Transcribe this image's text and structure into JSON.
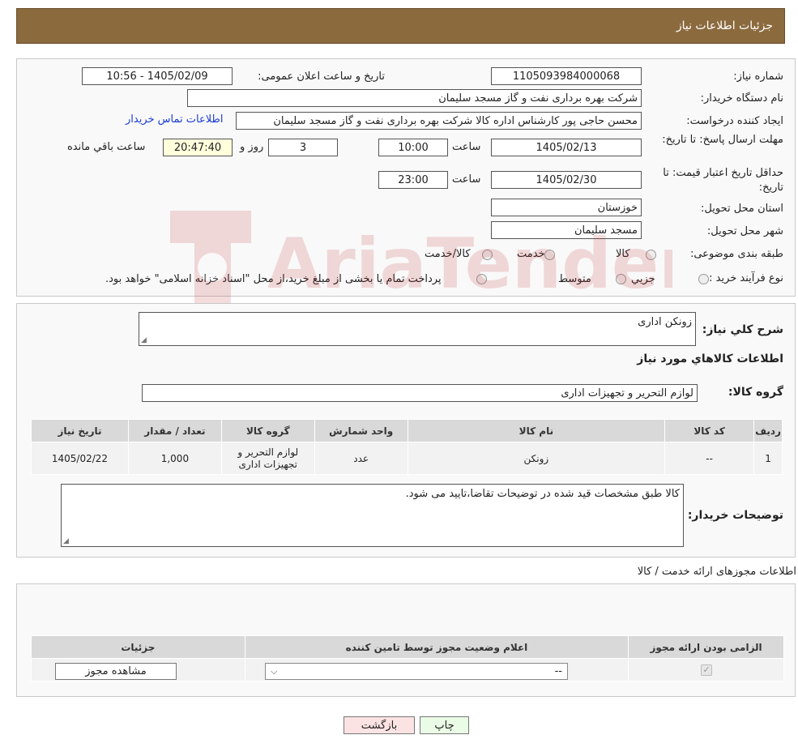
{
  "header": {
    "title": "جزئیات اطلاعات نیاز"
  },
  "form": {
    "need_number_label": "شماره نیاز:",
    "need_number": "1105093984000068",
    "announce_label": "تاریخ و ساعت اعلان عمومی:",
    "announce_value": "1405/02/09 - 10:56",
    "buyer_label": "نام دستگاه خریدار:",
    "buyer_value": "شرکت بهره برداری نفت و گاز مسجد سلیمان",
    "creator_label": "ایجاد کننده درخواست:",
    "creator_value": "محسن حاجی پور کارشناس اداره کالا  شرکت بهره برداری نفت و گاز مسجد سلیمان",
    "contact_link": "اطلاعات تماس خریدار",
    "deadline_label": "مهلت ارسال پاسخ: تا تاریخ:",
    "deadline_date": "1405/02/13",
    "time_label": "ساعت",
    "deadline_time": "10:00",
    "days_value": "3",
    "days_label": "روز و",
    "remaining_time": "20:47:40",
    "remaining_label": "ساعت باقي مانده",
    "validity_label": "حداقل تاریخ اعتبار قیمت: تا تاریخ:",
    "validity_date": "1405/02/30",
    "validity_time": "23:00",
    "province_label": "استان محل تحویل:",
    "province_value": "خوزستان",
    "city_label": "شهر محل تحویل:",
    "city_value": "مسجد سلیمان",
    "category_label": "طبقه بندی موضوعی:",
    "category_options": [
      "کالا",
      "خدمت",
      "کالا/خدمت"
    ],
    "process_label": "نوع فرآیند خرید :",
    "process_options": [
      "جزیي",
      "متوسط"
    ],
    "process_note": "پرداخت تمام یا بخشی از مبلغ خرید،از محل \"اسناد خزانه اسلامی\" خواهد بود."
  },
  "details": {
    "summary_label": "شرح کلي نياز:",
    "summary_value": "زونکن اداری",
    "goods_title": "اطلاعات کالاهاي مورد نياز",
    "group_label": "گروه کالا:",
    "group_value": "لوازم التحریر و تجهیزات اداری",
    "table": {
      "headers": [
        "رديف",
        "کد کالا",
        "نام کالا",
        "واحد شمارش",
        "گروه کالا",
        "تعداد / مقدار",
        "تاريخ نياز"
      ],
      "rows": [
        [
          "1",
          "--",
          "زونکن",
          "عدد",
          "لوازم التحریر و تجهیزات اداری",
          "1,000",
          "1405/02/22"
        ]
      ]
    },
    "buyer_notes_label": "توضيحات خريدار:",
    "buyer_notes_value": "کالا طبق مشخصات قید شده در توضیحات تقاضا،تایید می شود."
  },
  "permits": {
    "title": "اطلاعات مجوزهای ارائه خدمت / کالا",
    "headers": [
      "الزامی بودن ارائه مجوز",
      "اعلام وضعیت مجوز توسط تامین کننده",
      "جزئیات"
    ],
    "select_value": "--",
    "view_button": "مشاهده مجوز"
  },
  "footer": {
    "print_button": "چاپ",
    "back_button": "بازگشت"
  },
  "watermark": {
    "text": "AriaTender.neT"
  }
}
